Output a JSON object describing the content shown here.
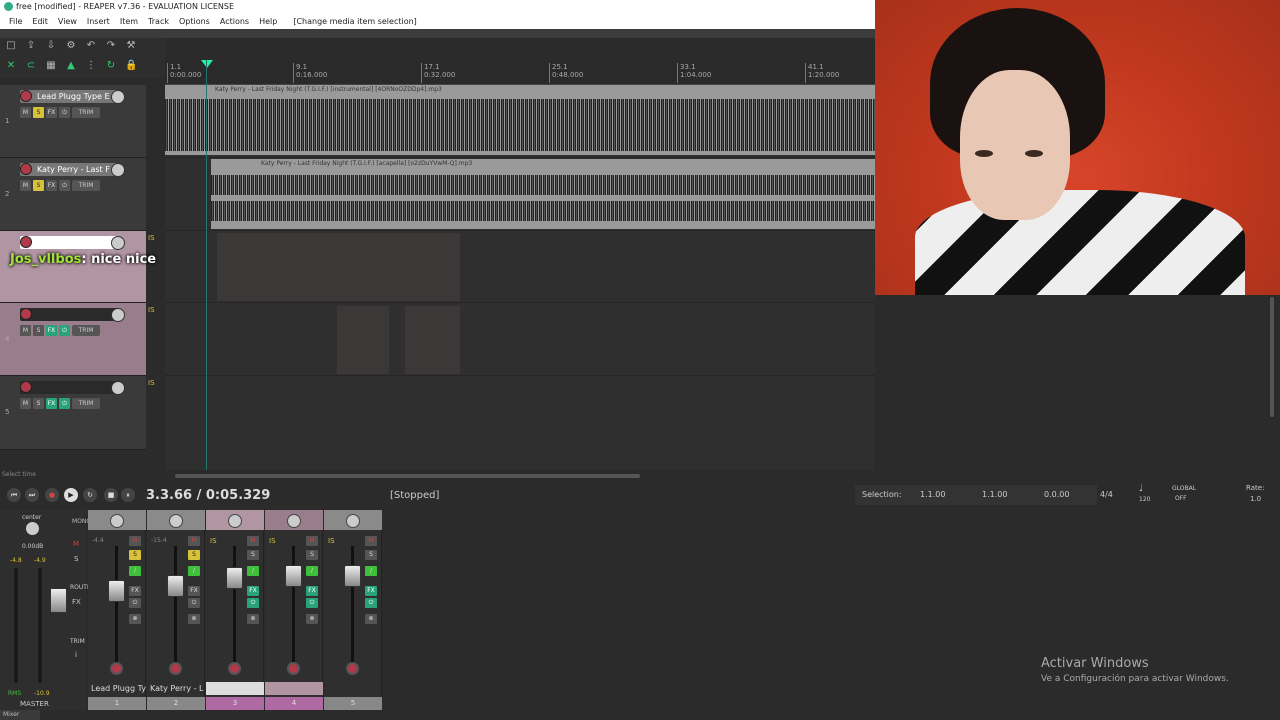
{
  "window": {
    "title": "free [modified] - REAPER v7.36 - EVALUATION LICENSE"
  },
  "menu": {
    "items": [
      "File",
      "Edit",
      "View",
      "Insert",
      "Item",
      "Track",
      "Options",
      "Actions",
      "Help"
    ],
    "context": "[Change media item selection]"
  },
  "ruler": {
    "marks": [
      {
        "bar": "1.1",
        "time": "0:00.000"
      },
      {
        "bar": "9.1",
        "time": "0:16.000"
      },
      {
        "bar": "17.1",
        "time": "0:32.000"
      },
      {
        "bar": "25.1",
        "time": "0:48.000"
      },
      {
        "bar": "33.1",
        "time": "1:04.000"
      },
      {
        "bar": "41.1",
        "time": "1:20.000"
      }
    ]
  },
  "tracks": [
    {
      "num": "1",
      "name": "Lead Plugg Type E"
    },
    {
      "num": "2",
      "name": "Katy Perry - Last F"
    },
    {
      "num": "3",
      "name": ""
    },
    {
      "num": "4",
      "name": ""
    },
    {
      "num": "5",
      "name": ""
    }
  ],
  "items": {
    "item1": "Katy Perry - Last Friday Night (T.G.I.F.) [instrumental] [4ORNoOZDDp4].mp3",
    "item2": "Katy Perry - Last Friday Night (T.G.I.F.) [acapella] [o2zDuYVwM-Q].mp3"
  },
  "chat": {
    "user": "Jos_vllbos",
    "message": ": nice nice"
  },
  "transport": {
    "position": "3.3.66 / 0:05.329",
    "status": "[Stopped]",
    "selection_label": "Selection:",
    "sel_start": "1.1.00",
    "sel_end": "1.1.00",
    "sel_len": "0.0.00",
    "timesig": "4/4",
    "bpm": "120",
    "rate_label": "Rate:",
    "rate": "1.0",
    "global": "GLOBAL",
    "global_state": "OFF"
  },
  "hscroll_label": "Select time",
  "mixer": {
    "master_label": "MASTER",
    "center": "center",
    "master_db": "0.00dB",
    "rms": "RMS",
    "rms_val": "-10.9",
    "ml": "-4.8",
    "mr": "-4.9",
    "strips": [
      {
        "num": "1",
        "name": "Lead Plugg Ty",
        "vol": "-4.4"
      },
      {
        "num": "2",
        "name": "Katy Perry - L",
        "vol": "-15.4"
      },
      {
        "num": "3",
        "name": ""
      },
      {
        "num": "4",
        "name": ""
      },
      {
        "num": "5",
        "name": ""
      }
    ],
    "tab": "Mixer"
  },
  "windows_activation": {
    "title": "Activar Windows",
    "subtitle": "Ve a Configuración para activar Windows."
  },
  "colors": {
    "track_pink": "#b295a3",
    "accent_green": "#2aa37a",
    "solo_yellow": "#d8c23a",
    "record_red": "#b03a4a",
    "webcam_bg": "#c0381e"
  }
}
